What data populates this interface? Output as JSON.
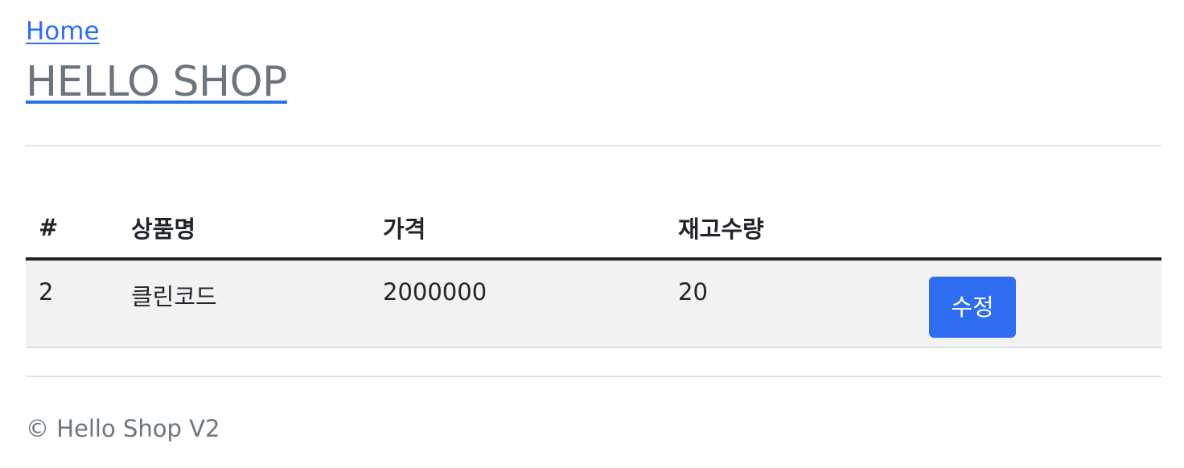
{
  "nav": {
    "home_label": "Home",
    "brand": "HELLO SHOP"
  },
  "table": {
    "headers": [
      "#",
      "상품명",
      "가격",
      "재고수량",
      ""
    ],
    "rows": [
      {
        "id": "2",
        "name": "클린코드",
        "price": "2000000",
        "stock": "20",
        "action_label": "수정"
      }
    ]
  },
  "footer": {
    "text": "© Hello Shop V2"
  },
  "colors": {
    "accent": "#2f6df0",
    "muted_text": "#6c757d",
    "row_bg": "#f2f2f2"
  }
}
